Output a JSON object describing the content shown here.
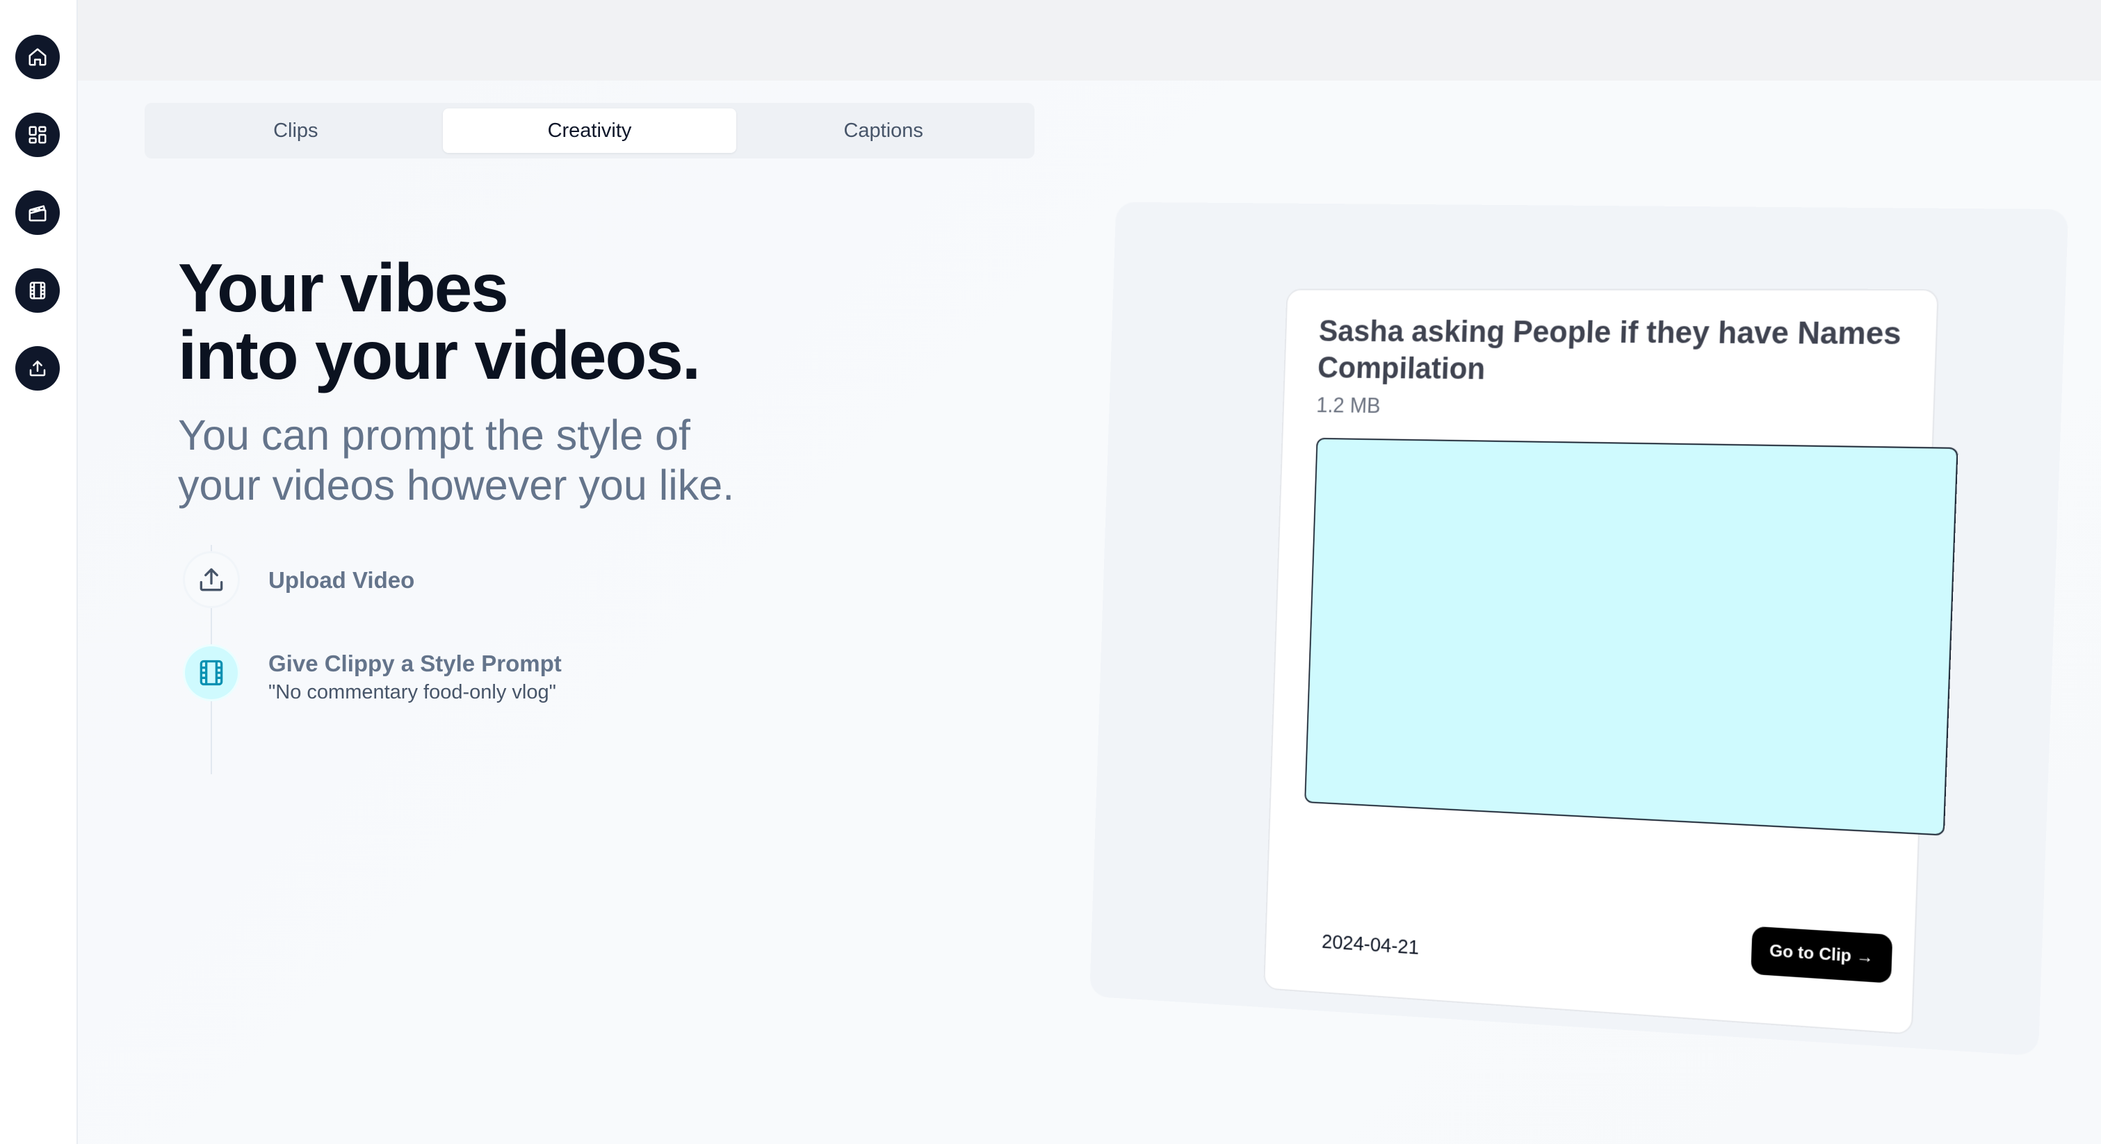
{
  "sidebar": {
    "items": [
      {
        "icon": "home-icon"
      },
      {
        "icon": "dashboard-icon"
      },
      {
        "icon": "clapperboard-icon"
      },
      {
        "icon": "film-icon"
      },
      {
        "icon": "upload-icon"
      }
    ]
  },
  "tabs": {
    "items": [
      {
        "label": "Clips"
      },
      {
        "label": "Creativity"
      },
      {
        "label": "Captions"
      }
    ],
    "active": "Creativity"
  },
  "hero": {
    "title_line1": "Your vibes",
    "title_line2": "into your videos.",
    "subtitle_line1": "You can prompt the style of",
    "subtitle_line2": "your videos however you like."
  },
  "steps": [
    {
      "icon": "upload-icon",
      "label": "Upload Video",
      "description": ""
    },
    {
      "icon": "film-icon",
      "label": "Give Clippy a Style Prompt",
      "description": "\"No commentary food-only vlog\""
    }
  ],
  "card": {
    "title": "Sasha asking People if they have Names Compilation",
    "size": "1.2 MB",
    "date": "2024-04-21",
    "button_label": "Go to Clip →",
    "thumbnail_color": "#cffafe"
  },
  "colors": {
    "sidebar_button": "#0f172a",
    "accent_cyan": "#06b6d4",
    "thumbnail": "#cffafe"
  }
}
